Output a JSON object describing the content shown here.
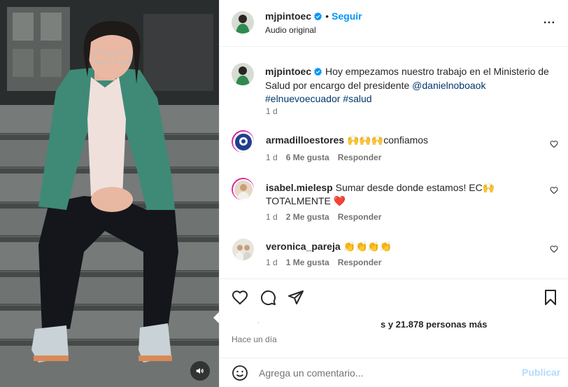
{
  "post": {
    "username": "mjpintoec",
    "separator": "•",
    "follow_label": "Seguir",
    "audio_label": "Audio original",
    "caption_text": "Hoy empezamos nuestro trabajo en el Ministerio de Salud por encargo del presidente",
    "caption_mention": "@danielnoboaok",
    "caption_hashtags": "#elnuevoecuador #salud",
    "caption_time": "1 d"
  },
  "comments": [
    {
      "username": "armadilloestores",
      "text": "🙌🙌🙌confiamos",
      "time": "1 d",
      "likes": "6 Me gusta",
      "reply_label": "Responder"
    },
    {
      "username": "isabel.mielesp",
      "text": "Sumar desde donde estamos! EC🙌 TOTALMENTE ❤️",
      "time": "1 d",
      "likes": "2 Me gusta",
      "reply_label": "Responder"
    },
    {
      "username": "veronica_pareja",
      "text": "👏👏👏👏",
      "time": "1 d",
      "likes": "1 Me gusta",
      "reply_label": "Responder"
    }
  ],
  "footer": {
    "likes_partial": "s y 21.878 personas más",
    "time_ago": "Hace un día",
    "comment_placeholder": "Agrega un comentario...",
    "publish_label": "Publicar"
  },
  "icons": {
    "like": "heart-icon",
    "comment": "comment-icon",
    "share": "share-icon",
    "save": "bookmark-icon",
    "more": "more-options-icon",
    "emoji": "emoji-icon",
    "sound": "sound-icon",
    "verified": "verified-badge-icon"
  },
  "colors": {
    "accent": "#0095f6",
    "verified": "#0095f6",
    "muted_text": "#737373",
    "link": "#00376b",
    "publish_disabled": "#b3dbff",
    "heart_red": "#ed4956"
  }
}
